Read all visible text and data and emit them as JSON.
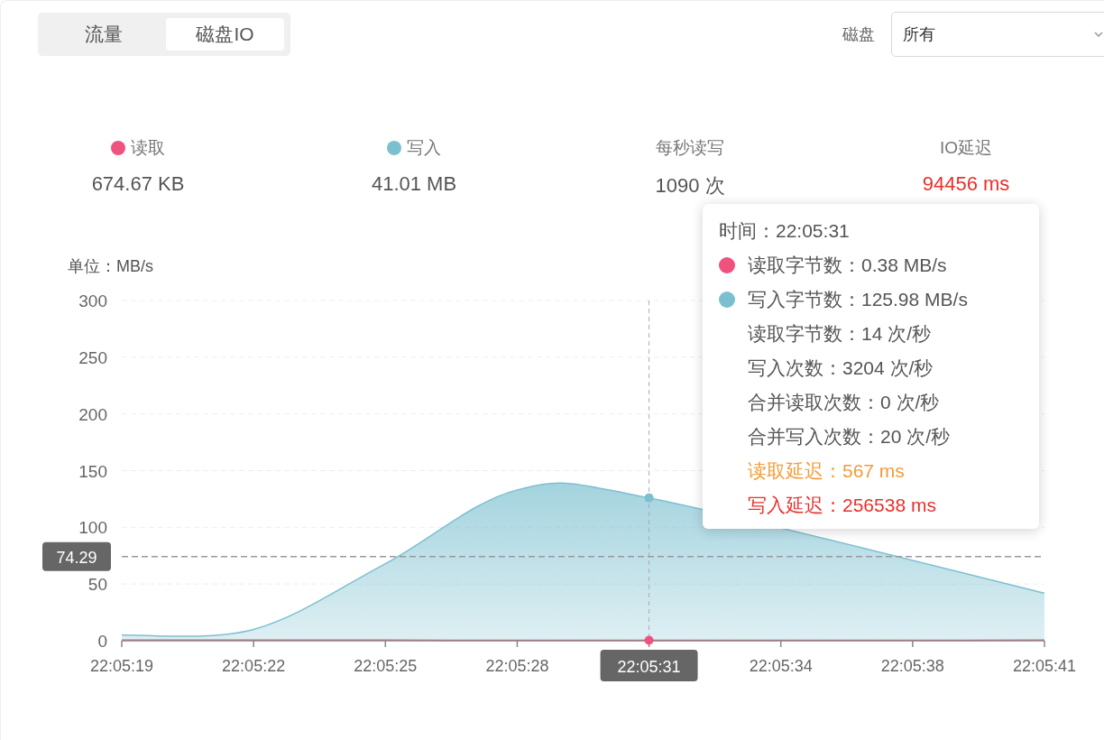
{
  "tabs": [
    {
      "label": "流量",
      "selected": false
    },
    {
      "label": "磁盘IO",
      "selected": true
    }
  ],
  "disk_filter": {
    "label": "磁盘",
    "value": "所有"
  },
  "stats": [
    {
      "label": "读取",
      "value": "674.67 KB",
      "color": "#f0527f",
      "alert": false
    },
    {
      "label": "写入",
      "value": "41.01 MB",
      "color": "#7cc0d0",
      "alert": false
    },
    {
      "label": "每秒读写",
      "value": "1090 次",
      "alert": false
    },
    {
      "label": "IO延迟",
      "value": "94456 ms",
      "alert": true
    }
  ],
  "chart": {
    "unit": "单位：MB/s",
    "chart_data": {
      "type": "area",
      "categories": [
        "22:05:19",
        "22:05:22",
        "22:05:25",
        "22:05:28",
        "22:05:31",
        "22:05:34",
        "22:05:38",
        "22:05:41"
      ],
      "ylim": [
        0,
        300
      ],
      "yticks": [
        0,
        50,
        100,
        150,
        200,
        250,
        300
      ],
      "grid": true,
      "ref_lines": [
        {
          "axis": "x",
          "value": "22:05:31"
        },
        {
          "axis": "y",
          "value": 74.29,
          "label": "74.29"
        }
      ],
      "series": [
        {
          "type": "area",
          "color": "#7cc0d0",
          "values": [
            5,
            10,
            68,
            133,
            126,
            null,
            null,
            42
          ]
        },
        {
          "type": "line",
          "color": "#f0527f",
          "values": [
            0.5,
            0.5,
            0.5,
            0.4,
            0.4,
            0.4,
            0.4,
            0.5
          ]
        }
      ]
    }
  },
  "tooltip": {
    "title": "时间：22:05:31",
    "rows": [
      {
        "text": "读取字节数：0.38 MB/s",
        "kind": "series",
        "color": "#f0527f"
      },
      {
        "text": "写入字节数：125.98 MB/s",
        "kind": "series",
        "color": "#7cc0d0"
      },
      {
        "text": "读取字节数：14 次/秒",
        "kind": "plain"
      },
      {
        "text": "写入次数：3204 次/秒",
        "kind": "plain"
      },
      {
        "text": "合并读取次数：0 次/秒",
        "kind": "plain"
      },
      {
        "text": "合并写入次数：20 次/秒",
        "kind": "plain"
      },
      {
        "text": "读取延迟：567 ms",
        "kind": "warning"
      },
      {
        "text": "写入延迟：256538 ms",
        "kind": "danger"
      }
    ]
  }
}
